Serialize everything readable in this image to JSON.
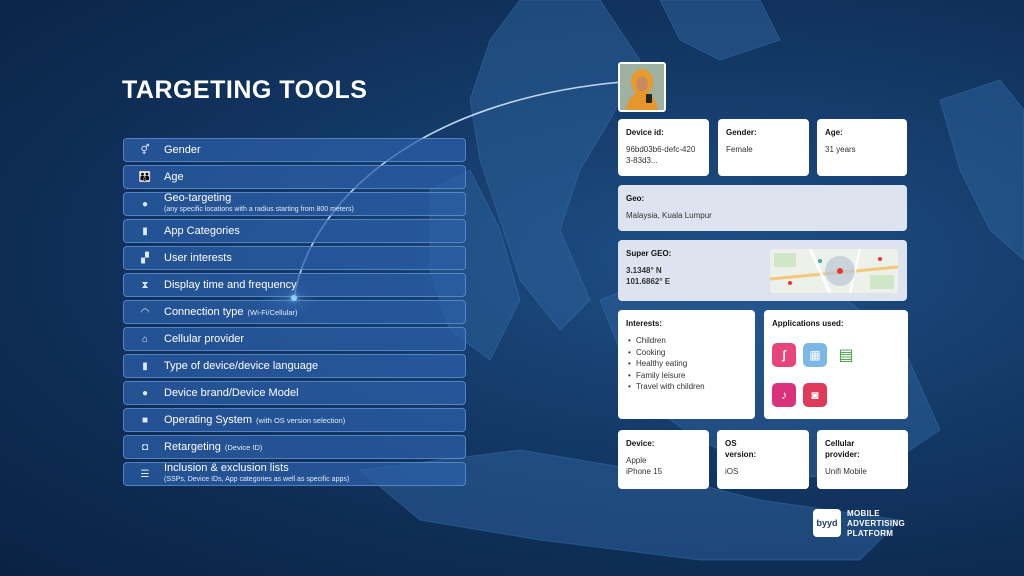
{
  "title": "TARGETING TOOLS",
  "tools": [
    {
      "icon": "gender-icon",
      "label": "Gender",
      "inline_sub": "",
      "sub": ""
    },
    {
      "icon": "age-icon",
      "label": "Age",
      "inline_sub": "",
      "sub": ""
    },
    {
      "icon": "location-pin-icon",
      "label": "Geo-targeting",
      "inline_sub": "",
      "sub": "(any specific locations with a radius starting from 800 meters)"
    },
    {
      "icon": "phone-icon",
      "label": "App Categories",
      "inline_sub": "",
      "sub": ""
    },
    {
      "icon": "user-interests-icon",
      "label": "User interests",
      "inline_sub": "",
      "sub": ""
    },
    {
      "icon": "hourglass-icon",
      "label": "Display time and frequency",
      "inline_sub": "",
      "sub": ""
    },
    {
      "icon": "wifi-icon",
      "label": "Connection type",
      "inline_sub": "(Wi-Fi/Cellular)",
      "sub": ""
    },
    {
      "icon": "cellular-tower-icon",
      "label": "Cellular provider",
      "inline_sub": "",
      "sub": ""
    },
    {
      "icon": "device-icon",
      "label": "Type of device/device language",
      "inline_sub": "",
      "sub": ""
    },
    {
      "icon": "apple-icon",
      "label": "Device brand/Device Model",
      "inline_sub": "",
      "sub": ""
    },
    {
      "icon": "os-icon",
      "label": "Operating System",
      "inline_sub": "(with OS version selection)",
      "sub": ""
    },
    {
      "icon": "retargeting-icon",
      "label": "Retargeting",
      "inline_sub": "(Device ID)",
      "sub": ""
    },
    {
      "icon": "list-icon",
      "label": "Inclusion & exclusion lists",
      "inline_sub": "",
      "sub": "(SSPs, Device IDs, App categories as well as specific apps)"
    }
  ],
  "profile": {
    "device_id": {
      "label": "Device id:",
      "value": "96bd03b6-defc-4203-83d3..."
    },
    "gender": {
      "label": "Gender:",
      "value": "Female"
    },
    "age": {
      "label": "Age:",
      "value": "31 years"
    },
    "geo": {
      "label": "Geo:",
      "value": "Malaysia, Kuala Lumpur"
    },
    "super_geo": {
      "label": "Super GEO:",
      "lat": "3.1348° N",
      "lon": "101.6862° E"
    },
    "interests": {
      "label": "Interests:",
      "items": [
        "Children",
        "Cooking",
        "Healthy eating",
        "Family leisure",
        "Travel with children"
      ]
    },
    "apps": {
      "label": "Applications used:"
    },
    "device": {
      "label": "Device:",
      "line1": "Apple",
      "line2": "iPhone 15"
    },
    "os": {
      "label1": "OS",
      "label2": "version:",
      "value": "iOS"
    },
    "cellular": {
      "label1": "Cellular",
      "label2": "provider:",
      "value": "Unifi Mobile"
    }
  },
  "brand": {
    "logo": "byyd",
    "line1": "MOBILE",
    "line2": "ADVERTISING",
    "line3": "PLATFORM"
  },
  "colors": {
    "background": "#143a68",
    "tool_bg": "#2c60aa",
    "card_bg": "#ffffff",
    "card_grey": "#dde4ef",
    "app_pink": "#e8457d",
    "app_magenta": "#d9327a",
    "app_red": "#e03a5a",
    "app_blue": "#7bb8e8",
    "app_green": "#3f9e3f"
  }
}
